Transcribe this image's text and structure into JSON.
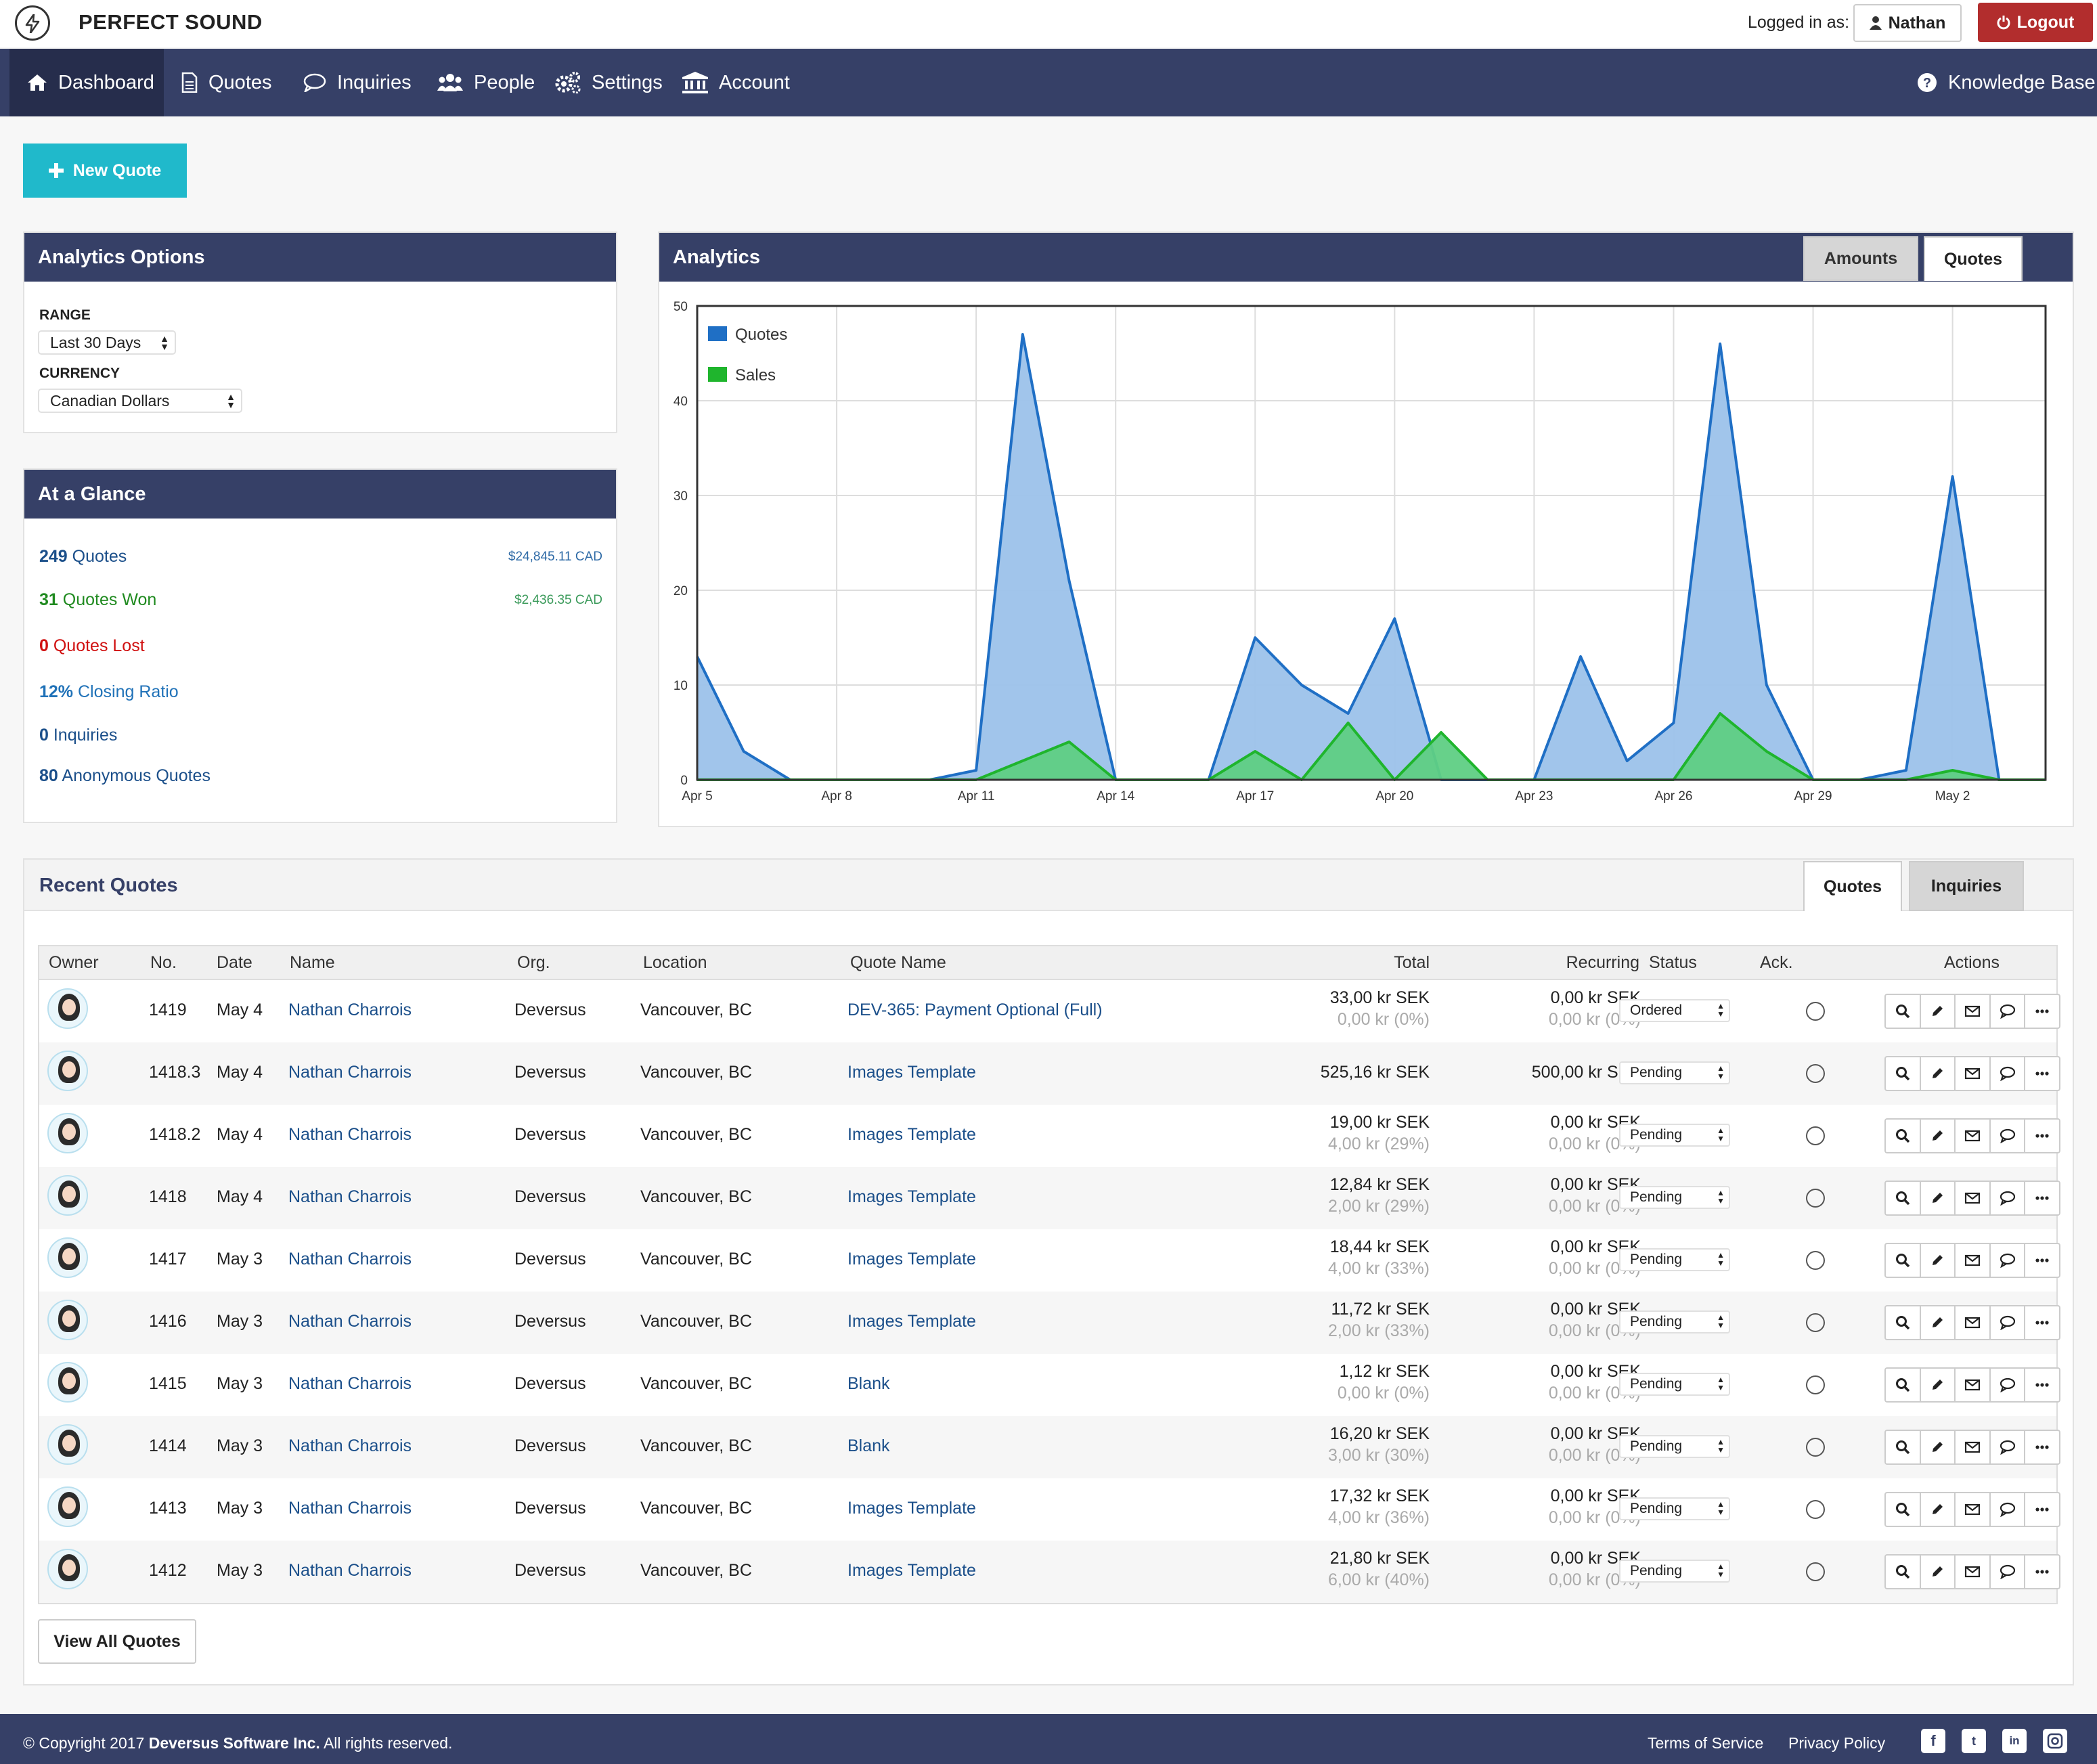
{
  "brand": {
    "name": "PERFECT SOUND"
  },
  "header": {
    "logged_in_label": "Logged in as:",
    "user_name": "Nathan",
    "logout_label": "Logout"
  },
  "nav": {
    "items": [
      {
        "label": "Dashboard",
        "icon": "home-icon"
      },
      {
        "label": "Quotes",
        "icon": "document-icon"
      },
      {
        "label": "Inquiries",
        "icon": "chat-icon"
      },
      {
        "label": "People",
        "icon": "people-icon"
      },
      {
        "label": "Settings",
        "icon": "gears-icon"
      },
      {
        "label": "Account",
        "icon": "bank-icon"
      }
    ],
    "knowledge_base": "Knowledge Base"
  },
  "new_quote_label": "New Quote",
  "analytics_options": {
    "title": "Analytics Options",
    "range_label": "RANGE",
    "range_value": "Last 30 Days",
    "currency_label": "CURRENCY",
    "currency_value": "Canadian Dollars"
  },
  "at_a_glance": {
    "title": "At a Glance",
    "quotes_count": "249",
    "quotes_label": "Quotes",
    "quotes_amount": "$24,845.11 CAD",
    "won_count": "31",
    "won_label": "Quotes Won",
    "won_amount": "$2,436.35 CAD",
    "lost_count": "0",
    "lost_label": "Quotes Lost",
    "ratio_value": "12%",
    "ratio_label": "Closing Ratio",
    "inquiries_count": "0",
    "inquiries_label": "Inquiries",
    "anon_count": "80",
    "anon_label": "Anonymous Quotes"
  },
  "analytics": {
    "title": "Analytics",
    "tab_amounts": "Amounts",
    "tab_quotes": "Quotes",
    "active_tab": "Quotes"
  },
  "chart_data": {
    "type": "area",
    "title": "",
    "x": [
      "Apr 5",
      "Apr 6",
      "Apr 7",
      "Apr 8",
      "Apr 9",
      "Apr 10",
      "Apr 11",
      "Apr 12",
      "Apr 13",
      "Apr 14",
      "Apr 15",
      "Apr 16",
      "Apr 17",
      "Apr 18",
      "Apr 19",
      "Apr 20",
      "Apr 21",
      "Apr 22",
      "Apr 23",
      "Apr 24",
      "Apr 25",
      "Apr 26",
      "Apr 27",
      "Apr 28",
      "Apr 29",
      "Apr 30",
      "May 1",
      "May 2",
      "May 3",
      "May 4"
    ],
    "x_tick_labels": [
      "Apr 5",
      "Apr 8",
      "Apr 11",
      "Apr 14",
      "Apr 17",
      "Apr 20",
      "Apr 23",
      "Apr 26",
      "Apr 29",
      "May 2"
    ],
    "series": [
      {
        "name": "Quotes",
        "color": "#1f6fc5",
        "fill": "#9cc2ea",
        "values": [
          13,
          3,
          0,
          0,
          0,
          0,
          1,
          47,
          21,
          0,
          0,
          0,
          15,
          10,
          7,
          17,
          0,
          0,
          0,
          13,
          2,
          6,
          46,
          10,
          0,
          0,
          1,
          32,
          0,
          0
        ]
      },
      {
        "name": "Sales",
        "color": "#1fb52d",
        "fill": "#5fcf84",
        "values": [
          0,
          0,
          0,
          0,
          0,
          0,
          0,
          2,
          4,
          0,
          0,
          0,
          3,
          0,
          6,
          0,
          5,
          0,
          0,
          0,
          0,
          0,
          7,
          3,
          0,
          0,
          0,
          1,
          0,
          0
        ]
      }
    ],
    "ylim": [
      0,
      50
    ],
    "y_ticks": [
      0,
      10,
      20,
      30,
      40,
      50
    ],
    "grid": true,
    "legend_position": "top-left"
  },
  "recent_quotes": {
    "title": "Recent Quotes",
    "tab_quotes": "Quotes",
    "tab_inquiries": "Inquiries",
    "columns": [
      "Owner",
      "No.",
      "Date",
      "Name",
      "Org.",
      "Location",
      "Quote Name",
      "Total",
      "Recurring",
      "Status",
      "Ack.",
      "Actions"
    ],
    "rows": [
      {
        "no": "1419",
        "date": "May 4",
        "name": "Nathan Charrois",
        "org": "Deversus",
        "location": "Vancouver, BC",
        "quote_name": "DEV-365: Payment Optional (Full)",
        "total": "33,00 kr SEK",
        "total_sub": "0,00 kr (0%)",
        "recurring": "0,00 kr SEK",
        "recurring_sub": "0,00 kr (0%)",
        "status": "Ordered"
      },
      {
        "no": "1418.3",
        "date": "May 4",
        "name": "Nathan Charrois",
        "org": "Deversus",
        "location": "Vancouver, BC",
        "quote_name": "Images Template",
        "total": "525,16 kr SEK",
        "total_sub": "",
        "recurring": "500,00 kr SEK",
        "recurring_sub": "",
        "status": "Pending"
      },
      {
        "no": "1418.2",
        "date": "May 4",
        "name": "Nathan Charrois",
        "org": "Deversus",
        "location": "Vancouver, BC",
        "quote_name": "Images Template",
        "total": "19,00 kr SEK",
        "total_sub": "4,00 kr (29%)",
        "recurring": "0,00 kr SEK",
        "recurring_sub": "0,00 kr (0%)",
        "status": "Pending"
      },
      {
        "no": "1418",
        "date": "May 4",
        "name": "Nathan Charrois",
        "org": "Deversus",
        "location": "Vancouver, BC",
        "quote_name": "Images Template",
        "total": "12,84 kr SEK",
        "total_sub": "2,00 kr (29%)",
        "recurring": "0,00 kr SEK",
        "recurring_sub": "0,00 kr (0%)",
        "status": "Pending"
      },
      {
        "no": "1417",
        "date": "May 3",
        "name": "Nathan Charrois",
        "org": "Deversus",
        "location": "Vancouver, BC",
        "quote_name": "Images Template",
        "total": "18,44 kr SEK",
        "total_sub": "4,00 kr (33%)",
        "recurring": "0,00 kr SEK",
        "recurring_sub": "0,00 kr (0%)",
        "status": "Pending"
      },
      {
        "no": "1416",
        "date": "May 3",
        "name": "Nathan Charrois",
        "org": "Deversus",
        "location": "Vancouver, BC",
        "quote_name": "Images Template",
        "total": "11,72 kr SEK",
        "total_sub": "2,00 kr (33%)",
        "recurring": "0,00 kr SEK",
        "recurring_sub": "0,00 kr (0%)",
        "status": "Pending"
      },
      {
        "no": "1415",
        "date": "May 3",
        "name": "Nathan Charrois",
        "org": "Deversus",
        "location": "Vancouver, BC",
        "quote_name": "Blank",
        "total": "1,12 kr SEK",
        "total_sub": "0,00 kr (0%)",
        "recurring": "0,00 kr SEK",
        "recurring_sub": "0,00 kr (0%)",
        "status": "Pending"
      },
      {
        "no": "1414",
        "date": "May 3",
        "name": "Nathan Charrois",
        "org": "Deversus",
        "location": "Vancouver, BC",
        "quote_name": "Blank",
        "total": "16,20 kr SEK",
        "total_sub": "3,00 kr (30%)",
        "recurring": "0,00 kr SEK",
        "recurring_sub": "0,00 kr (0%)",
        "status": "Pending"
      },
      {
        "no": "1413",
        "date": "May 3",
        "name": "Nathan Charrois",
        "org": "Deversus",
        "location": "Vancouver, BC",
        "quote_name": "Images Template",
        "total": "17,32 kr SEK",
        "total_sub": "4,00 kr (36%)",
        "recurring": "0,00 kr SEK",
        "recurring_sub": "0,00 kr (0%)",
        "status": "Pending"
      },
      {
        "no": "1412",
        "date": "May 3",
        "name": "Nathan Charrois",
        "org": "Deversus",
        "location": "Vancouver, BC",
        "quote_name": "Images Template",
        "total": "21,80 kr SEK",
        "total_sub": "6,00 kr (40%)",
        "recurring": "0,00 kr SEK",
        "recurring_sub": "0,00 kr (0%)",
        "status": "Pending"
      }
    ],
    "view_all_label": "View All Quotes"
  },
  "footer": {
    "copyright_prefix": "© Copyright 2017",
    "company": "Deversus Software Inc.",
    "copyright_suffix": "All rights reserved.",
    "terms": "Terms of Service",
    "privacy": "Privacy Policy",
    "social_icons": [
      "facebook-icon",
      "twitter-icon",
      "linkedin-icon",
      "instagram-icon"
    ]
  },
  "colors": {
    "nav": "#364067",
    "accent": "#20b9cb",
    "logout": "#b22d2d",
    "link": "#1b4f8a",
    "won": "#1f8a1f",
    "lost": "#d01010"
  }
}
